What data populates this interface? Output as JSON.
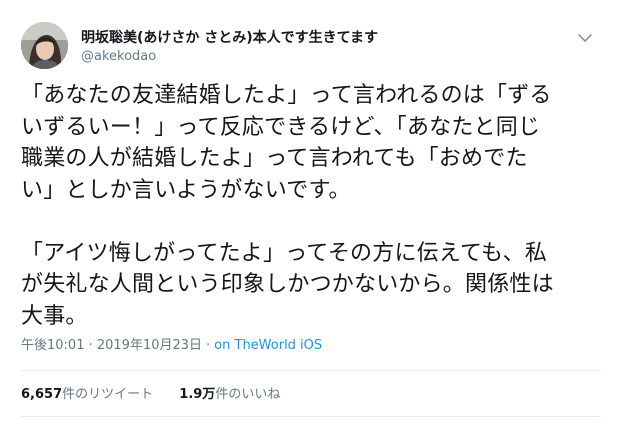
{
  "tweet": {
    "author": {
      "display_name": "明坂聡美(あけさか さとみ)本人です生きてます",
      "handle": "@akekodao"
    },
    "text": "「あなたの友達結婚したよ」って言われるのは「ずる\nいずるいー！」って反応できるけど、「あなたと同じ\n職業の人が結婚したよ」って言われても「おめでた\nい」としか言いようがないです。\n\n「アイツ悔しがってたよ」ってその方に伝えても、私\nが失礼な人間という印象しかつかないから。関係性は\n大事。",
    "timestamp": "午後10:01 · 2019年10月23日",
    "separator": "·",
    "source": "on TheWorld iOS",
    "retweets": {
      "count": "6,657",
      "label": "件のリツイート"
    },
    "likes": {
      "count": "1.9万",
      "label": "件のいいね"
    }
  },
  "icons": {
    "menu": "chevron-down-icon",
    "avatar": "avatar"
  },
  "colors": {
    "text": "#14171a",
    "secondary": "#657786",
    "link": "#1b95e0",
    "divider": "#e6ecf0"
  }
}
